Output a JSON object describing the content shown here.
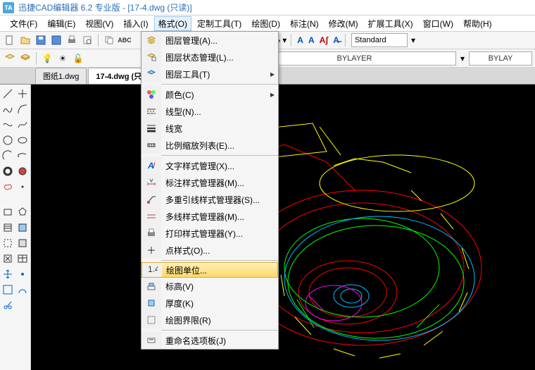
{
  "title": "迅捷CAD编辑器 6.2 专业版  - [17-4.dwg (只读)]",
  "app_icon": "TA",
  "menubar": [
    {
      "label": "文件(F)"
    },
    {
      "label": "编辑(E)"
    },
    {
      "label": "视图(V)"
    },
    {
      "label": "插入(I)"
    },
    {
      "label": "格式(O)",
      "active": true
    },
    {
      "label": "定制工具(T)"
    },
    {
      "label": "绘图(D)"
    },
    {
      "label": "标注(N)"
    },
    {
      "label": "修改(M)"
    },
    {
      "label": "扩展工具(X)"
    },
    {
      "label": "窗口(W)"
    },
    {
      "label": "帮助(H)"
    }
  ],
  "dropdown": {
    "groups": [
      [
        {
          "label": "图层管理(A)...",
          "icon": "layers"
        },
        {
          "label": "图层状态管理(L)...",
          "icon": "layers-state"
        },
        {
          "label": "图层工具(T)",
          "icon": "layer-tool",
          "submenu": true
        }
      ],
      [
        {
          "label": "颜色(C)",
          "icon": "palette",
          "submenu": true
        },
        {
          "label": "线型(N)...",
          "icon": "linetype"
        },
        {
          "label": "线宽",
          "icon": "lineweight"
        },
        {
          "label": "比例缩放列表(E)...",
          "icon": "scale"
        }
      ],
      [
        {
          "label": "文字样式管理(X)...",
          "icon": "text-style"
        },
        {
          "label": "标注样式管理器(M)...",
          "icon": "dim-style"
        },
        {
          "label": "多重引线样式管理器(S)...",
          "icon": "mleader"
        },
        {
          "label": "多线样式管理器(M)...",
          "icon": "mline"
        },
        {
          "label": "打印样式管理器(Y)...",
          "icon": "print-style"
        },
        {
          "label": "点样式(O)...",
          "icon": "point-style"
        }
      ],
      [
        {
          "label": "绘图单位...",
          "icon": "units",
          "highlight": true
        },
        {
          "label": "标高(V)",
          "icon": "elevation"
        },
        {
          "label": "厚度(K)",
          "icon": "thickness"
        },
        {
          "label": "绘图界限(R)",
          "icon": "limits"
        }
      ],
      [
        {
          "label": "重命名选项板(J)",
          "icon": "rename"
        }
      ]
    ]
  },
  "tabs": [
    {
      "label": "图纸1.dwg"
    },
    {
      "label": "17-4.dwg (只读",
      "active": true
    }
  ],
  "layer_dropdown1": "BYLAYER",
  "layer_dropdown2": "BYLAY",
  "text_style": "Standard"
}
